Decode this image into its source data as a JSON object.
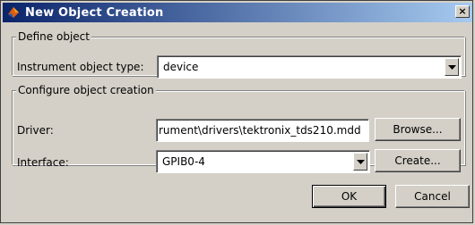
{
  "window": {
    "title": "New Object Creation",
    "close_glyph": "×"
  },
  "define_object": {
    "legend": "Define object",
    "type_label": "Instrument object type:",
    "type_value": "device"
  },
  "configure": {
    "legend": "Configure object creation",
    "driver_label": "Driver:",
    "driver_value": "rument\\drivers\\tektronix_tds210.mdd",
    "browse_label": "Browse...",
    "interface_label": "Interface:",
    "interface_value": "GPIB0-4",
    "create_label": "Create..."
  },
  "buttons": {
    "ok_label": "OK",
    "cancel_label": "Cancel"
  },
  "colors": {
    "title_start": "#0a246a",
    "title_end": "#a6caf0",
    "face": "#d4d0c8"
  }
}
